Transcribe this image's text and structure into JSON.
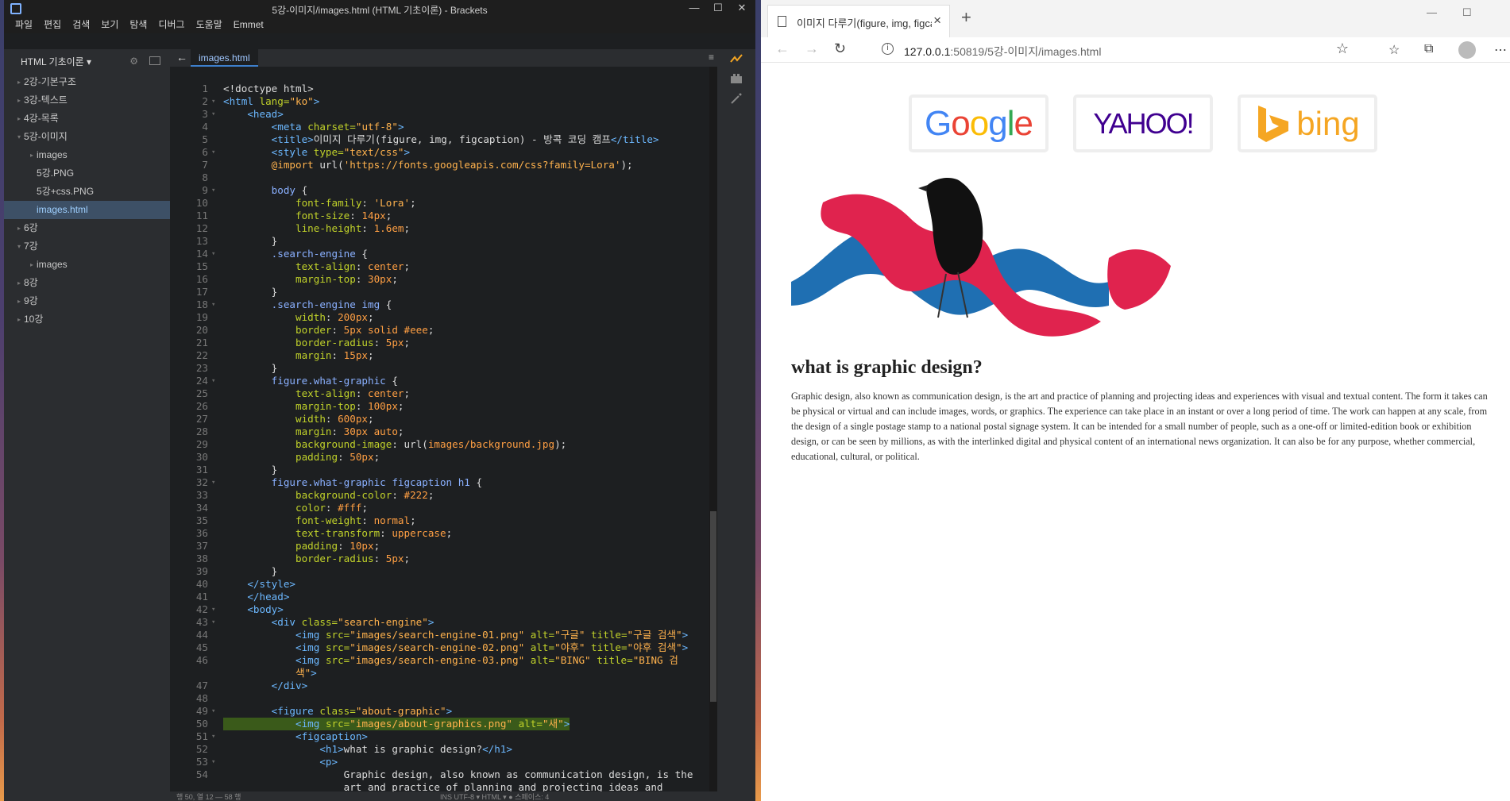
{
  "brackets": {
    "window_title": "5강-이미지/images.html (HTML 기초이론) - Brackets",
    "menu": [
      "파일",
      "편집",
      "검색",
      "보기",
      "탐색",
      "디버그",
      "도움말",
      "Emmet"
    ],
    "project_name": "HTML 기초이론 ▾",
    "tree": [
      {
        "label": "2강-기본구조",
        "indent": 0,
        "arrow": "▸"
      },
      {
        "label": "3강-텍스트",
        "indent": 0,
        "arrow": "▸"
      },
      {
        "label": "4강-목록",
        "indent": 0,
        "arrow": "▸"
      },
      {
        "label": "5강-이미지",
        "indent": 0,
        "arrow": "▾"
      },
      {
        "label": "images",
        "indent": 1,
        "arrow": "▸"
      },
      {
        "label": "5강.PNG",
        "indent": 1,
        "arrow": ""
      },
      {
        "label": "5강+css.PNG",
        "indent": 1,
        "arrow": ""
      },
      {
        "label": "images.html",
        "indent": 1,
        "arrow": "",
        "selected": true
      },
      {
        "label": "6강",
        "indent": 0,
        "arrow": "▸"
      },
      {
        "label": "7강",
        "indent": 0,
        "arrow": "▾"
      },
      {
        "label": "images",
        "indent": 1,
        "arrow": "▸"
      },
      {
        "label": "8강",
        "indent": 0,
        "arrow": "▸"
      },
      {
        "label": "9강",
        "indent": 0,
        "arrow": "▸"
      },
      {
        "label": "10강",
        "indent": 0,
        "arrow": "▸"
      }
    ],
    "active_tab": "images.html",
    "code_lines": [
      {
        "n": "1",
        "f": "",
        "h": "&lt;!doctype html&gt;"
      },
      {
        "n": "2",
        "f": "▾",
        "h": "<span class=t>&lt;html</span> <span class=a>lang=</span><span class=s>\"ko\"</span><span class=t>&gt;</span>"
      },
      {
        "n": "3",
        "f": "▾",
        "h": "    <span class=t>&lt;head&gt;</span>"
      },
      {
        "n": "4",
        "f": "",
        "h": "        <span class=t>&lt;meta</span> <span class=a>charset=</span><span class=s>\"utf-8\"</span><span class=t>&gt;</span>"
      },
      {
        "n": "5",
        "f": "",
        "h": "        <span class=t>&lt;title&gt;</span>이미지 다루기(figure, img, figcaption) - 방콕 코딩 캠프<span class=t>&lt;/title&gt;</span>"
      },
      {
        "n": "6",
        "f": "▾",
        "h": "        <span class=t>&lt;style</span> <span class=a>type=</span><span class=s>\"text/css\"</span><span class=t>&gt;</span>"
      },
      {
        "n": "7",
        "f": "",
        "h": "        <span class=s>@import</span> <span class=k>url(</span><span class=s>'https://fonts.googleapis.com/css?family=Lora'</span>);"
      },
      {
        "n": "8",
        "f": "",
        "h": ""
      },
      {
        "n": "9",
        "f": "▾",
        "h": "        <span class=c>body</span> {"
      },
      {
        "n": "10",
        "f": "",
        "h": "            <span class=a>font-family</span>: <span class=s>'Lora'</span>;"
      },
      {
        "n": "11",
        "f": "",
        "h": "            <span class=a>font-size</span>: <span class=v>14px</span>;"
      },
      {
        "n": "12",
        "f": "",
        "h": "            <span class=a>line-height</span>: <span class=v>1.6em</span>;"
      },
      {
        "n": "13",
        "f": "",
        "h": "        }"
      },
      {
        "n": "14",
        "f": "▾",
        "h": "        <span class=c>.search-engine</span> {"
      },
      {
        "n": "15",
        "f": "",
        "h": "            <span class=a>text-align</span>: <span class=v>center</span>;"
      },
      {
        "n": "16",
        "f": "",
        "h": "            <span class=a>margin-top</span>: <span class=v>30px</span>;"
      },
      {
        "n": "17",
        "f": "",
        "h": "        }"
      },
      {
        "n": "18",
        "f": "▾",
        "h": "        <span class=c>.search-engine img</span> {"
      },
      {
        "n": "19",
        "f": "",
        "h": "            <span class=a>width</span>: <span class=v>200px</span>;"
      },
      {
        "n": "20",
        "f": "",
        "h": "            <span class=a>border</span>: <span class=v>5px solid #eee</span>;"
      },
      {
        "n": "21",
        "f": "",
        "h": "            <span class=a>border-radius</span>: <span class=v>5px</span>;"
      },
      {
        "n": "22",
        "f": "",
        "h": "            <span class=a>margin</span>: <span class=v>15px</span>;"
      },
      {
        "n": "23",
        "f": "",
        "h": "        }"
      },
      {
        "n": "24",
        "f": "▾",
        "h": "        <span class=c>figure.what-graphic</span> {"
      },
      {
        "n": "25",
        "f": "",
        "h": "            <span class=a>text-align</span>: <span class=v>center</span>;"
      },
      {
        "n": "26",
        "f": "",
        "h": "            <span class=a>margin-top</span>: <span class=v>100px</span>;"
      },
      {
        "n": "27",
        "f": "",
        "h": "            <span class=a>width</span>: <span class=v>600px</span>;"
      },
      {
        "n": "28",
        "f": "",
        "h": "            <span class=a>margin</span>: <span class=v>30px auto</span>;"
      },
      {
        "n": "29",
        "f": "",
        "h": "            <span class=a>background-image</span>: <span class=k>url(</span><span class=v>images/background.jpg</span>);"
      },
      {
        "n": "30",
        "f": "",
        "h": "            <span class=a>padding</span>: <span class=v>50px</span>;"
      },
      {
        "n": "31",
        "f": "",
        "h": "        }"
      },
      {
        "n": "32",
        "f": "▾",
        "h": "        <span class=c>figure.what-graphic figcaption h1</span> {"
      },
      {
        "n": "33",
        "f": "",
        "h": "            <span class=a>background-color</span>: <span class=v>#222</span>;"
      },
      {
        "n": "34",
        "f": "",
        "h": "            <span class=a>color</span>: <span class=v>#fff</span>;"
      },
      {
        "n": "35",
        "f": "",
        "h": "            <span class=a>font-weight</span>: <span class=v>normal</span>;"
      },
      {
        "n": "36",
        "f": "",
        "h": "            <span class=a>text-transform</span>: <span class=v>uppercase</span>;"
      },
      {
        "n": "37",
        "f": "",
        "h": "            <span class=a>padding</span>: <span class=v>10px</span>;"
      },
      {
        "n": "38",
        "f": "",
        "h": "            <span class=a>border-radius</span>: <span class=v>5px</span>;"
      },
      {
        "n": "39",
        "f": "",
        "h": "        }"
      },
      {
        "n": "40",
        "f": "",
        "h": "    <span class=t>&lt;/style&gt;</span>"
      },
      {
        "n": "41",
        "f": "",
        "h": "    <span class=t>&lt;/head&gt;</span>"
      },
      {
        "n": "42",
        "f": "▾",
        "h": "    <span class=t>&lt;body&gt;</span>"
      },
      {
        "n": "43",
        "f": "▾",
        "h": "        <span class=t>&lt;div</span> <span class=a>class=</span><span class=s>\"search-engine\"</span><span class=t>&gt;</span>"
      },
      {
        "n": "44",
        "f": "",
        "h": "            <span class=t>&lt;img</span> <span class=a>src=</span><span class=s>\"images/search-engine-01.png\"</span> <span class=a>alt=</span><span class=s>\"구글\"</span> <span class=a>title=</span><span class=s>\"구글 검색\"</span><span class=t>&gt;</span>"
      },
      {
        "n": "45",
        "f": "",
        "h": "            <span class=t>&lt;img</span> <span class=a>src=</span><span class=s>\"images/search-engine-02.png\"</span> <span class=a>alt=</span><span class=s>\"야후\"</span> <span class=a>title=</span><span class=s>\"야후 검색\"</span><span class=t>&gt;</span>"
      },
      {
        "n": "46",
        "f": "",
        "h": "            <span class=t>&lt;img</span> <span class=a>src=</span><span class=s>\"images/search-engine-03.png\"</span> <span class=a>alt=</span><span class=s>\"BING\"</span> <span class=a>title=</span><span class=s>\"BING 검</span>"
      },
      {
        "n": "",
        "f": "",
        "h": "            <span class=s>색\"</span><span class=t>&gt;</span>"
      },
      {
        "n": "47",
        "f": "",
        "h": "        <span class=t>&lt;/div&gt;</span>"
      },
      {
        "n": "48",
        "f": "",
        "h": ""
      },
      {
        "n": "49",
        "f": "▾",
        "h": "        <span class=t>&lt;figure</span> <span class=a>class=</span><span class=s>\"about-graphic\"</span><span class=t>&gt;</span>"
      },
      {
        "n": "50",
        "f": "",
        "hl": true,
        "h": "            <span class=t>&lt;img</span> <span class=a>src=</span><span class=s>\"images/about-graphics.png\"</span> <span class=a>alt=</span><span class=s>\"새\"</span><span class=t>&gt;</span>"
      },
      {
        "n": "51",
        "f": "▾",
        "h": "            <span class=t>&lt;figcaption&gt;</span>"
      },
      {
        "n": "52",
        "f": "",
        "h": "                <span class=t>&lt;h1&gt;</span>what is graphic design?<span class=t>&lt;/h1&gt;</span>"
      },
      {
        "n": "53",
        "f": "▾",
        "h": "                <span class=t>&lt;p&gt;</span>"
      },
      {
        "n": "54",
        "f": "",
        "h": "                    Graphic design, also known as communication design, is the"
      },
      {
        "n": "",
        "f": "",
        "h": "                    art and practice of planning and projecting ideas and"
      }
    ],
    "status_left": "행 50, 열 12 — 58 행",
    "status_right": "INS    UTF-8 ▾    HTML ▾    ●    스페이스: 4"
  },
  "browser": {
    "tab_title": "이미지 다루기(figure, img, figcaption) - 방콕 코딩 캠프",
    "url_host": "127.0.0.1",
    "url_rest": ":50819/5강-이미지/images.html",
    "page": {
      "search_engines": [
        {
          "name": "Google"
        },
        {
          "name": "YAHOO!"
        },
        {
          "name": "bing"
        }
      ],
      "image_alt": "새",
      "heading": "what is graphic design?",
      "paragraph": "Graphic design, also known as communication design, is the art and practice of planning and projecting ideas and experiences with visual and textual content. The form it takes can be physical or virtual and can include images, words, or graphics. The experience can take place in an instant or over a long period of time. The work can happen at any scale, from the design of a single postage stamp to a national postal signage system. It can be intended for a small number of people, such as a one-off or limited-edition book or exhibition design, or can be seen by millions, as with the interlinked digital and physical content of an international news organization. It can also be for any purpose, whether commercial, educational, cultural, or political."
    }
  }
}
